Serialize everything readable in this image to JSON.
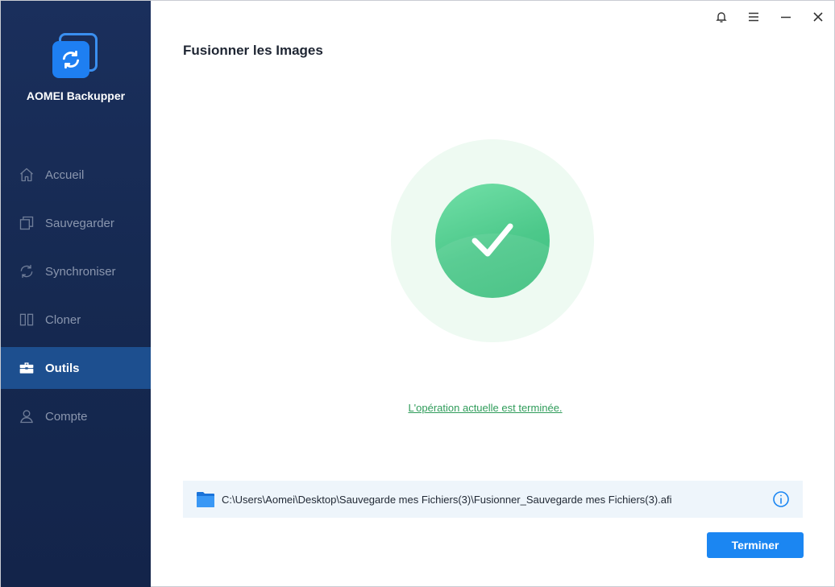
{
  "app": {
    "name": "AOMEI Backupper"
  },
  "sidebar": {
    "items": [
      {
        "label": "Accueil",
        "icon": "home-icon",
        "active": false
      },
      {
        "label": "Sauvegarder",
        "icon": "backup-icon",
        "active": false
      },
      {
        "label": "Synchroniser",
        "icon": "sync-icon",
        "active": false
      },
      {
        "label": "Cloner",
        "icon": "clone-icon",
        "active": false
      },
      {
        "label": "Outils",
        "icon": "toolbox-icon",
        "active": true
      },
      {
        "label": "Compte",
        "icon": "user-icon",
        "active": false
      }
    ]
  },
  "titlebar": {
    "icons": [
      "bell-icon",
      "menu-icon",
      "minimize-icon",
      "close-icon"
    ]
  },
  "main": {
    "title": "Fusionner les Images",
    "status": "L'opération actuelle est terminée.",
    "path": "C:\\Users\\Aomei\\Desktop\\Sauvegarde mes Fichiers(3)\\Fusionner_Sauvegarde mes Fichiers(3).afi",
    "finish_label": "Terminer"
  },
  "colors": {
    "sidebar_bg": "#15284f",
    "sidebar_active": "#1d4f8f",
    "accent": "#1b86f2",
    "success": "#4cc88a",
    "link": "#2f9c5a"
  }
}
